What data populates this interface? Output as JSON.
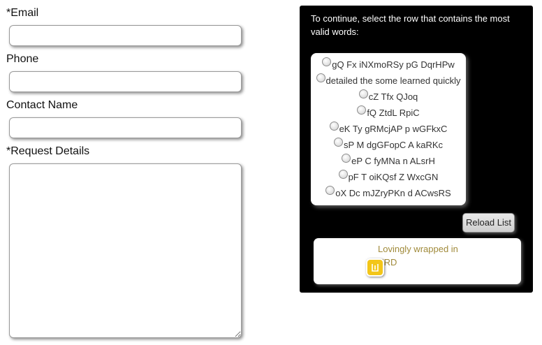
{
  "form": {
    "email_label": "*Email",
    "phone_label": "Phone",
    "contact_label": "Contact Name",
    "details_label": "*Request Details",
    "email_value": "",
    "phone_value": "",
    "contact_value": "",
    "details_value": ""
  },
  "captcha": {
    "instruction": "To continue, select the row that contains the most valid words:",
    "options": [
      "gQ Fx iNXmoRSy pG DqrHPw",
      "detailed the some learned quickly",
      "cZ Tfx QJoq",
      "fQ ZtdL RpiC",
      "eK Ty gRMcjAP p wGFkxC",
      "sP M dgGFopC A kaRKc",
      "eP C fyMNa n ALsrH",
      "pF T oiKQsf Z WxcGN",
      "oX Dc mJZryPKn d ACwsRS"
    ],
    "reload_label": "Reload List",
    "footer_line1": "Lovingly wrapped in",
    "footer_line2": "ERD",
    "footer_icon": "erd-logo-icon",
    "accent_color": "#f3c619"
  }
}
